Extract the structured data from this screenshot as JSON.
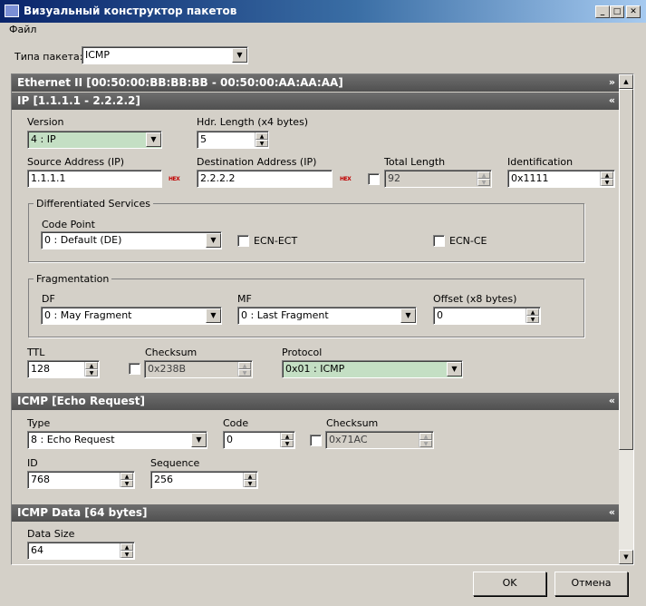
{
  "window": {
    "title": "Визуальный конструктор пакетов",
    "min_btn": "_",
    "max_btn": "□",
    "close_btn": "✕"
  },
  "menu": {
    "file": "Файл"
  },
  "packet_type": {
    "label": "Типа пакета:",
    "value": "ICMP"
  },
  "ethernet": {
    "header": "Ethernet II [00:50:00:BB:BB:BB - 00:50:00:AA:AA:AA]",
    "chevron": "»"
  },
  "ip": {
    "header": "IP [1.1.1.1 - 2.2.2.2]",
    "chevron": "«",
    "version": {
      "label": "Version",
      "value": "4 : IP"
    },
    "hdr_length": {
      "label": "Hdr. Length (x4 bytes)",
      "value": "5"
    },
    "source": {
      "label": "Source Address (IP)",
      "value": "1.1.1.1",
      "hex": "HEX"
    },
    "destination": {
      "label": "Destination Address (IP)",
      "value": "2.2.2.2",
      "hex": "HEX"
    },
    "total_length": {
      "label": "Total Length",
      "value": "92"
    },
    "identification": {
      "label": "Identification",
      "value": "0x1111"
    },
    "diffserv": {
      "title": "Differentiated Services",
      "code_point": {
        "label": "Code Point",
        "value": "0 : Default (DE)"
      },
      "ecn_ect": "ECN-ECT",
      "ecn_ce": "ECN-CE"
    },
    "fragmentation": {
      "title": "Fragmentation",
      "df": {
        "label": "DF",
        "value": "0 : May Fragment"
      },
      "mf": {
        "label": "MF",
        "value": "0 : Last Fragment"
      },
      "offset": {
        "label": "Offset (x8 bytes)",
        "value": "0"
      }
    },
    "ttl": {
      "label": "TTL",
      "value": "128"
    },
    "checksum": {
      "label": "Checksum",
      "value": "0x238B"
    },
    "protocol": {
      "label": "Protocol",
      "value": "0x01 : ICMP"
    }
  },
  "icmp": {
    "header": "ICMP [Echo Request]",
    "chevron": "«",
    "type": {
      "label": "Type",
      "value": "8 : Echo Request"
    },
    "code": {
      "label": "Code",
      "value": "0"
    },
    "checksum": {
      "label": "Checksum",
      "value": "0x71AC"
    },
    "id": {
      "label": "ID",
      "value": "768"
    },
    "sequence": {
      "label": "Sequence",
      "value": "256"
    }
  },
  "icmp_data": {
    "header": "ICMP Data [64 bytes]",
    "chevron": "«",
    "data_size": {
      "label": "Data Size",
      "value": "64"
    }
  },
  "buttons": {
    "ok": "OK",
    "cancel": "Отмена"
  },
  "colors": {
    "green_field": "#c4dfc4",
    "section_header": "#5a5a5a",
    "title_bar": "#0a246a"
  }
}
